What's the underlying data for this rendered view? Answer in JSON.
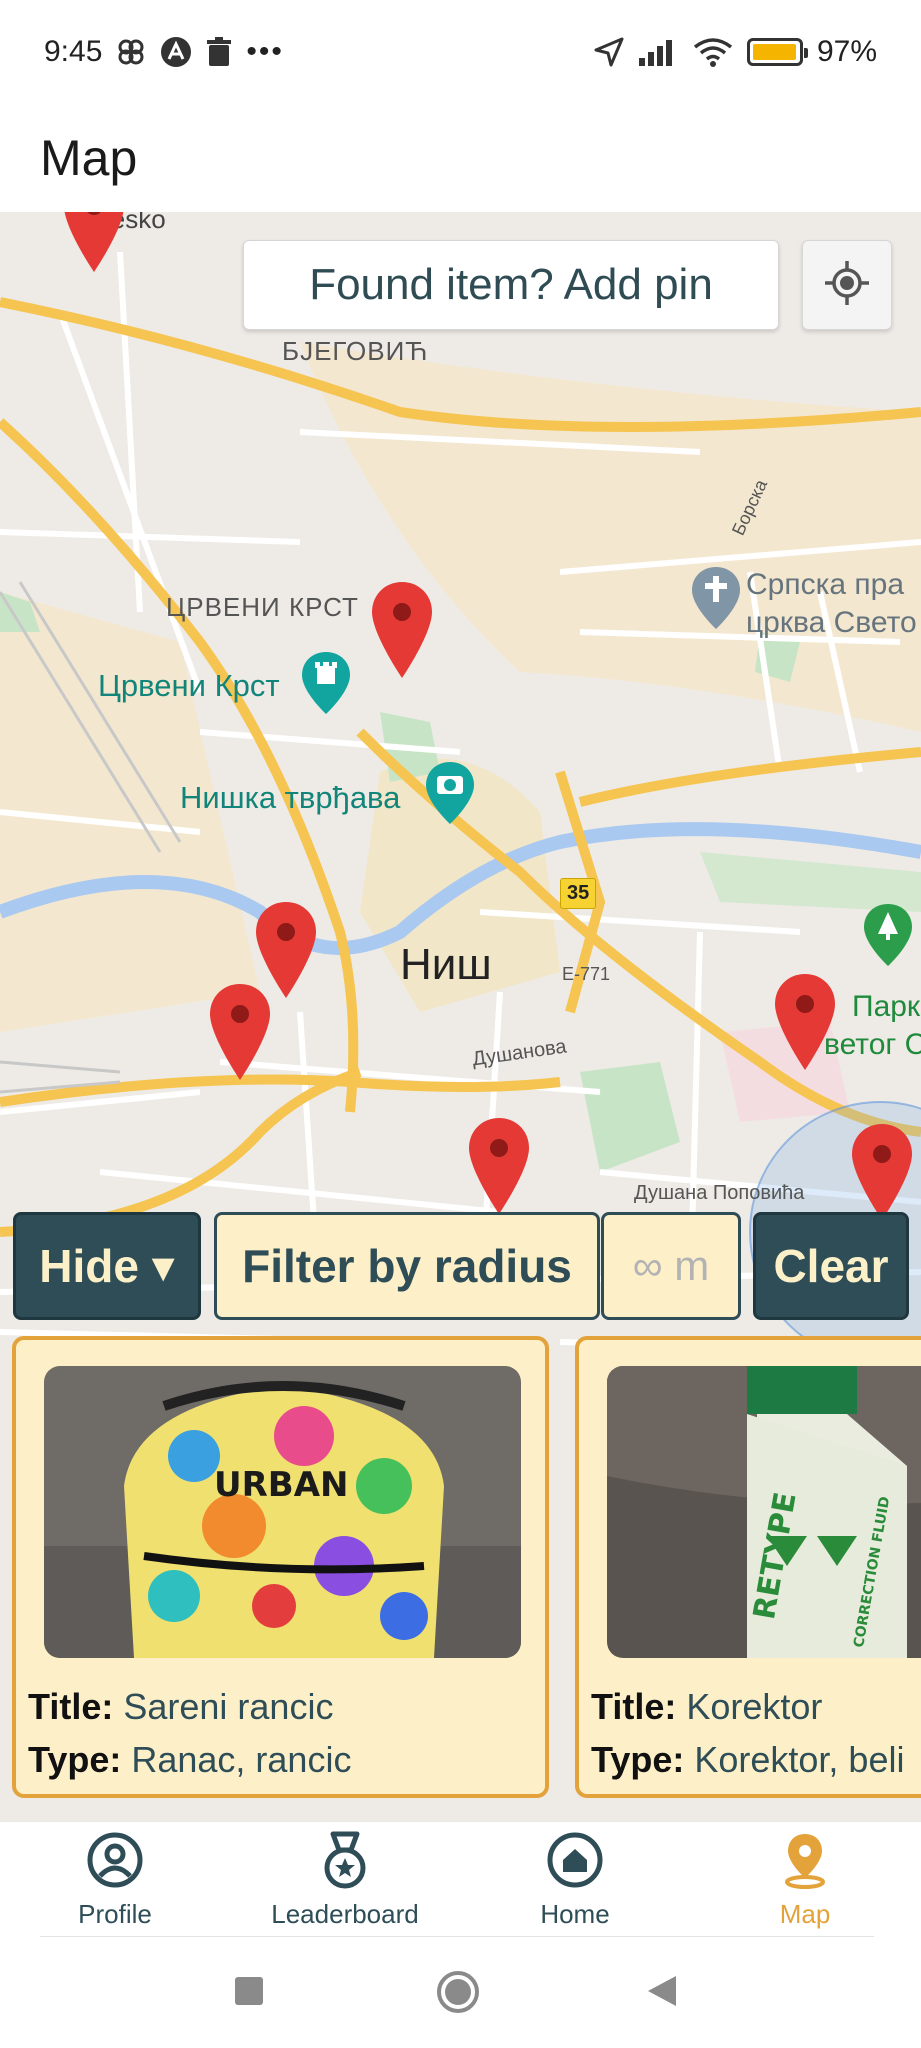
{
  "status_bar": {
    "time": "9:45",
    "more_indicator": "•••",
    "battery_percent": "97%",
    "battery_level": 0.97
  },
  "app_bar": {
    "title": "Map"
  },
  "map": {
    "add_pin_label": "Found item? Add pin",
    "labels": {
      "top_partial": "Nesko",
      "bjegovic": "БЈЕГОВИЋ",
      "crveni_krst_district": "ЦРВЕНИ КРСТ",
      "crveni_krst_poi": "Црвени Крст",
      "fortress": "Нишка тврђава",
      "church_line1": "Српска пра",
      "church_line2": "црква Свето",
      "borska": "Борска",
      "city": "Ниш",
      "road_35": "35",
      "e771": "E-771",
      "dusanova": "Душанова",
      "dusana_popovica": "Душана Поповића",
      "park_line1": "Парк",
      "park_line2": "ветог С"
    }
  },
  "filters": {
    "hide_label": "Hide ▾",
    "filter_label": "Filter by radius",
    "radius_placeholder": "∞ m",
    "clear_label": "Clear"
  },
  "cards": [
    {
      "title_key": "Title:",
      "title_value": "Sareni rancic",
      "type_key": "Type:",
      "type_value": "Ranac, rancic"
    },
    {
      "title_key": "Title:",
      "title_value": "Korektor",
      "type_key": "Type:",
      "type_value": "Korektor, beli"
    }
  ],
  "correction_fluid_label_1": "RETYPE",
  "correction_fluid_label_2": "CORRECTION FLUID",
  "bottom_nav": {
    "items": [
      {
        "label": "Profile",
        "icon": "profile-icon"
      },
      {
        "label": "Leaderboard",
        "icon": "medal-icon"
      },
      {
        "label": "Home",
        "icon": "home-icon"
      },
      {
        "label": "Map",
        "icon": "map-pin-icon",
        "active": true
      }
    ]
  },
  "colors": {
    "primary_dark": "#2f4d57",
    "cream": "#fdf0c9",
    "accent": "#e3a23a",
    "pin_red": "#e53935"
  }
}
